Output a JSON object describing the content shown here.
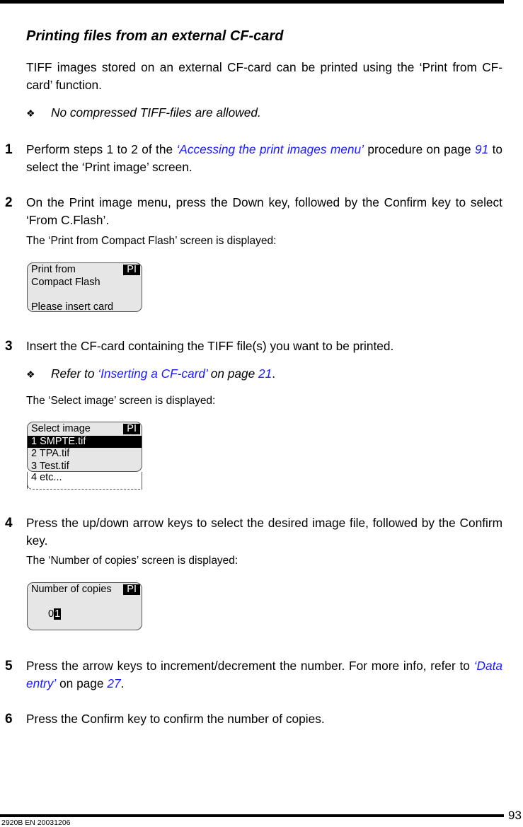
{
  "heading": "Printing files from an external CF-card",
  "intro": "TIFF images stored on an external CF-card can be printed using the ‘Print from CF-card’ function.",
  "note1": {
    "bullet": "❖",
    "text": "No compressed TIFF-files are allowed."
  },
  "steps": [
    {
      "num": "1",
      "pre": "Perform steps 1 to 2 of the ",
      "link": "‘Accessing the print images menu’",
      "mid": " procedure on page ",
      "page": "91",
      "post": " to select the ‘Print image’ screen."
    },
    {
      "num": "2",
      "text": "On the Print image menu, press the Down key, followed by the Confirm key to select ‘From C.Flash’.",
      "sub": "The ‘Print from Compact Flash’ screen is displayed:"
    },
    {
      "num": "3",
      "text": "Insert the CF-card containing the TIFF file(s) you want to be printed.",
      "note": {
        "bullet": "❖",
        "pre": "Refer to ",
        "link": "‘Inserting a CF-card’",
        "mid": " on page ",
        "page": "21",
        "post": "."
      },
      "sub": "The ‘Select image’ screen is displayed:"
    },
    {
      "num": "4",
      "text": "Press the up/down arrow keys to select the desired image file, followed by the Confirm key.",
      "sub": "The ‘Number of copies’ screen is displayed:"
    },
    {
      "num": "5",
      "pre": "Press the arrow keys to increment/decrement the number. For more info, refer to ",
      "link": "‘Data entry’",
      "mid": " on page ",
      "page": "27",
      "post": "."
    },
    {
      "num": "6",
      "text": "Press the Confirm key to confirm the number of copies."
    }
  ],
  "lcd1": {
    "badge": "PI",
    "lines": [
      "Print from",
      "Compact Flash",
      "",
      "Please insert card"
    ]
  },
  "lcd2": {
    "badge": "PI",
    "title": "Select image",
    "items": [
      "1 SMPTE.tif",
      "2 TPA.tif",
      "3 Test.tif"
    ],
    "overflow": "4 etc...",
    "selected_index": 0
  },
  "lcd3": {
    "badge": "PI",
    "title": "Number of copies",
    "value_prefix": "0",
    "value_cursor": "1"
  },
  "footer": {
    "page_number": "93",
    "doc_id": "2920B EN 20031206"
  }
}
